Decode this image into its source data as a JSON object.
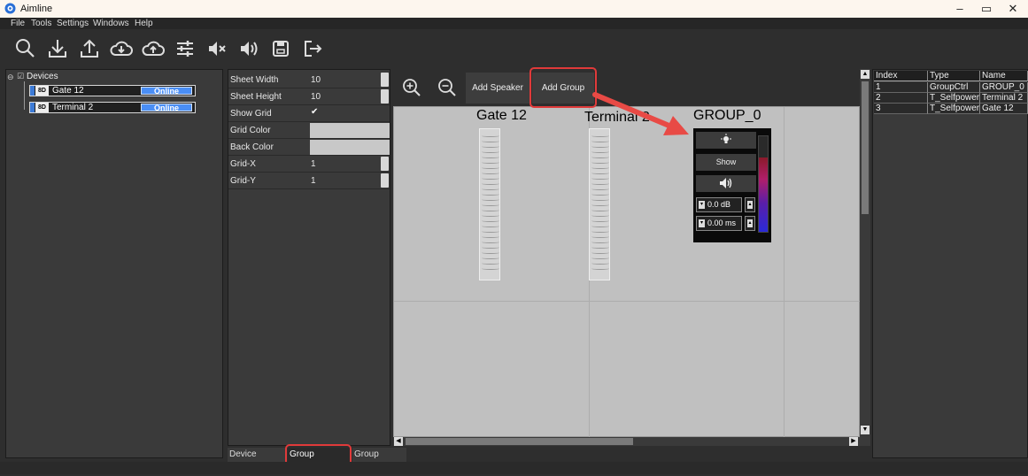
{
  "window": {
    "title": "Aimline",
    "min_icon": "minimize-icon",
    "max_icon": "maximize-icon",
    "close_icon": "close-icon"
  },
  "menu": [
    "File",
    "Tools",
    "Settings",
    "Windows",
    "Help"
  ],
  "toolbar": [
    "search-icon",
    "download-icon",
    "upload-icon",
    "cloud-download-icon",
    "cloud-upload-icon",
    "equalizer-icon",
    "mute-icon",
    "volume-icon",
    "save-icon",
    "exit-icon"
  ],
  "devices": {
    "root_label": "Devices",
    "items": [
      {
        "tag": "8D",
        "name": "Gate 12",
        "status": "Online"
      },
      {
        "tag": "8D",
        "name": "Terminal 2",
        "status": "Online"
      }
    ]
  },
  "properties": [
    {
      "label": "Sheet Width",
      "value": "10",
      "kind": "spin"
    },
    {
      "label": "Sheet Height",
      "value": "10",
      "kind": "spin"
    },
    {
      "label": "Show Grid",
      "value": "✔",
      "kind": "check"
    },
    {
      "label": "Grid Color",
      "value": "",
      "kind": "color"
    },
    {
      "label": "Back Color",
      "value": "",
      "kind": "color"
    },
    {
      "label": "Grid-X",
      "value": "1",
      "kind": "spin"
    },
    {
      "label": "Grid-Y",
      "value": "1",
      "kind": "spin"
    }
  ],
  "tabs": [
    "Device Control",
    "Group Manager",
    "Group Control"
  ],
  "canvas": {
    "add_speaker": "Add Speaker",
    "add_group": "Add Group",
    "speakers": [
      "Gate 12",
      "Terminal 2"
    ],
    "group": {
      "name": "GROUP_0",
      "show": "Show",
      "gain": "0.0 dB",
      "delay": "0.00 ms"
    }
  },
  "table": {
    "headers": [
      "Index",
      "Type",
      "Name"
    ],
    "rows": [
      [
        "1",
        "GroupCtrl",
        "GROUP_0"
      ],
      [
        "2",
        "T_Selfpower",
        "Terminal 2"
      ],
      [
        "3",
        "T_Selfpower",
        "Gate 12"
      ]
    ]
  },
  "colors": {
    "highlight": "#e03a3a",
    "online": "#4a8ef5"
  }
}
